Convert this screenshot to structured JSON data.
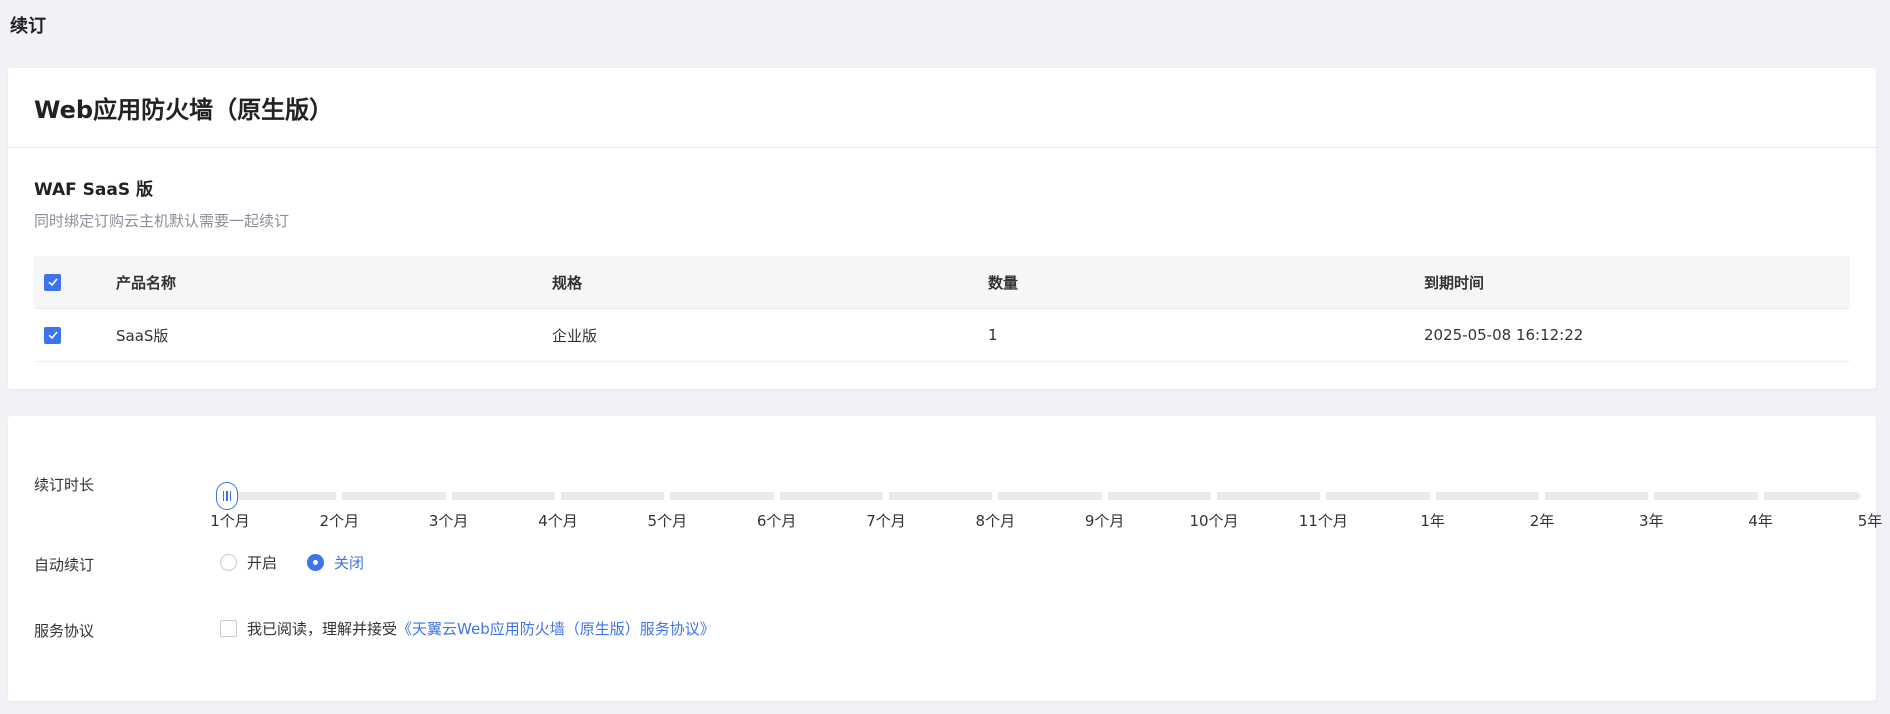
{
  "page": {
    "title": "续订"
  },
  "product": {
    "title": "Web应用防火墙（原生版）",
    "section_title": "WAF SaaS 版",
    "section_desc": "同时绑定订购云主机默认需要一起续订"
  },
  "table": {
    "headers": [
      "产品名称",
      "规格",
      "数量",
      "到期时间"
    ],
    "rows": [
      {
        "name": "SaaS版",
        "spec": "企业版",
        "qty": "1",
        "expire": "2025-05-08 16:12:22",
        "checked": true
      }
    ],
    "header_checked": true
  },
  "renewal": {
    "duration_label": "续订时长",
    "duration_options": [
      "1个月",
      "2个月",
      "3个月",
      "4个月",
      "5个月",
      "6个月",
      "7个月",
      "8个月",
      "9个月",
      "10个月",
      "11个月",
      "1年",
      "2年",
      "3年",
      "4年",
      "5年"
    ],
    "selected_index": 0,
    "auto_label": "自动续订",
    "auto_options": [
      "开启",
      "关闭"
    ],
    "auto_selected": "关闭",
    "agreement_label": "服务协议",
    "agreement_text": "我已阅读，理解并接受",
    "agreement_link": "《天翼云Web应用防火墙（原生版）服务协议》"
  },
  "colors": {
    "accent": "#3d74ed",
    "background": "#f0f2f5"
  }
}
